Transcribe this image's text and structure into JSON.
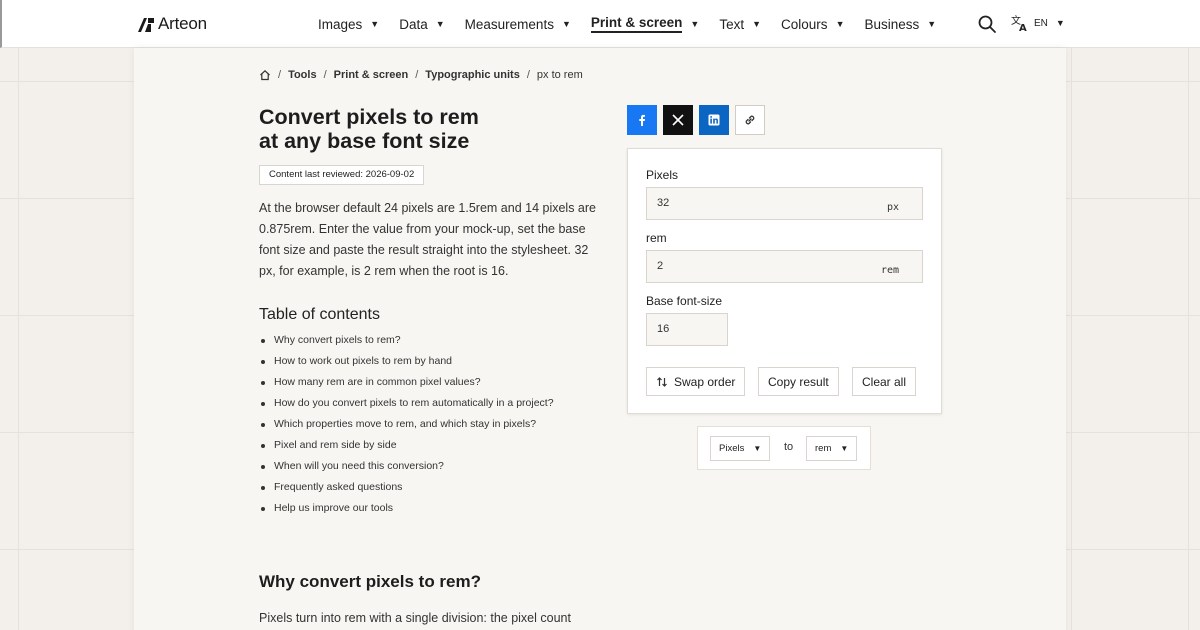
{
  "header": {
    "logo_text": "Arteon",
    "nav": [
      {
        "label": "Images"
      },
      {
        "label": "Data"
      },
      {
        "label": "Measurements"
      },
      {
        "label": "Print & screen"
      },
      {
        "label": "Text"
      },
      {
        "label": "Colours"
      },
      {
        "label": "Business"
      }
    ],
    "active_nav": "Print & screen",
    "language": "EN"
  },
  "breadcrumb": {
    "items": [
      "Tools",
      "Print & screen",
      "Typographic units"
    ],
    "current": "px to rem"
  },
  "article": {
    "title_line1": "Convert pixels to rem",
    "title_line2": "at any base font size",
    "reviewed": "Content last reviewed: 2026-09-02",
    "intro": "At the browser default 24 pixels are 1.5rem and 14 pixels are 0.875rem. Enter the value from your mock-up, set the base font size and paste the result straight into the stylesheet. 32 px, for example, is 2 rem when the root is 16.",
    "toc_title": "Table of contents",
    "toc": [
      "Why convert pixels to rem?",
      "How to work out pixels to rem by hand",
      "How many rem are in common pixel values?",
      "How do you convert pixels to rem automatically in a project?",
      "Which properties move to rem, and which stay in pixels?",
      "Pixel and rem side by side",
      "When will you need this conversion?",
      "Frequently asked questions",
      "Help us improve our tools"
    ],
    "section_heading": "Why convert pixels to rem?",
    "section_para": "Pixels turn into rem with a single division: the pixel count"
  },
  "converter": {
    "pixels_label": "Pixels",
    "pixels_value": "32",
    "pixels_unit": "px",
    "rem_label": "rem",
    "rem_value": "2",
    "rem_unit": "rem",
    "base_label": "Base font-size",
    "base_value": "16",
    "swap_label": "Swap order",
    "copy_label": "Copy result",
    "clear_label": "Clear all"
  },
  "unit_selector": {
    "from": "Pixels",
    "to_label": "to",
    "to": "rem"
  },
  "colors": {
    "facebook": "#1877f2",
    "x": "#111111",
    "linkedin": "#0a66c2"
  }
}
